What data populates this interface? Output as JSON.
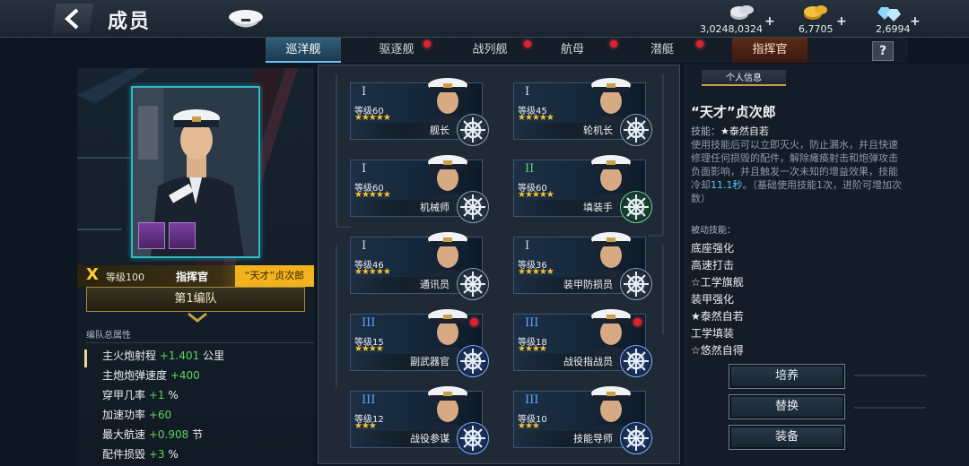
{
  "header": {
    "title": "成员",
    "currencies": [
      {
        "icon": "silver-coins-icon",
        "amount": "3,0248,0324"
      },
      {
        "icon": "gold-coins-icon",
        "amount": "6,7705"
      },
      {
        "icon": "diamond-icon",
        "amount": "2,6994"
      }
    ],
    "plus": "+"
  },
  "tabs": [
    {
      "label": "巡洋舰",
      "active": true,
      "alert": false
    },
    {
      "label": "驱逐舰",
      "active": false,
      "alert": true
    },
    {
      "label": "战列舰",
      "active": false,
      "alert": true
    },
    {
      "label": "航母",
      "active": false,
      "alert": true
    },
    {
      "label": "潜艇",
      "active": false,
      "alert": true
    },
    {
      "label": "指挥官",
      "active": false,
      "alert": false
    }
  ],
  "help_label": "?",
  "commander": {
    "rank": "X",
    "level": "等级100",
    "role": "指挥官",
    "name": "“天才”贞次郎",
    "fleet": "第1编队"
  },
  "fleet_stats": {
    "heading": "编队总属性",
    "rows": [
      {
        "label": "主火炮射程",
        "value": "+1.401",
        "unit": "公里"
      },
      {
        "label": "主炮炮弹速度",
        "value": "+400",
        "unit": ""
      },
      {
        "label": "穿甲几率",
        "value": "+1",
        "unit": "%"
      },
      {
        "label": "加速功率",
        "value": "+60",
        "unit": ""
      },
      {
        "label": "最大航速",
        "value": "+0.908",
        "unit": "节"
      },
      {
        "label": "配件损毁",
        "value": "+3",
        "unit": "%"
      }
    ]
  },
  "crew": [
    {
      "roman": "I",
      "grade": "white",
      "level": "等级60",
      "stars": "★★★★★",
      "role": "舰长",
      "icon": "helm-wheel-icon",
      "alert": false
    },
    {
      "roman": "I",
      "grade": "white",
      "level": "等级45",
      "stars": "★★★★★",
      "role": "轮机长",
      "icon": "gear-icon",
      "alert": false
    },
    {
      "roman": "I",
      "grade": "white",
      "level": "等级60",
      "stars": "★★★★★",
      "role": "机械师",
      "icon": "helm-wheel-icon",
      "alert": false
    },
    {
      "roman": "II",
      "grade": "green",
      "level": "等级60",
      "stars": "★★★★★",
      "role": "填装手",
      "icon": "shell-loader-icon",
      "alert": false
    },
    {
      "roman": "I",
      "grade": "white",
      "level": "等级46",
      "stars": "★★★★★",
      "role": "通讯员",
      "icon": "radio-tower-icon",
      "alert": false
    },
    {
      "roman": "I",
      "grade": "white",
      "level": "等级36",
      "stars": "★★★★★",
      "role": "装甲防损员",
      "icon": "wrench-icon",
      "alert": false
    },
    {
      "roman": "III",
      "grade": "blue",
      "level": "等级15",
      "stars": "★★★★",
      "role": "副武器官",
      "icon": "torpedo-icon",
      "alert": true
    },
    {
      "roman": "III",
      "grade": "blue",
      "level": "等级18",
      "stars": "★★★★",
      "role": "战役指战员",
      "icon": "flag-icon",
      "alert": true
    },
    {
      "roman": "III",
      "grade": "blue",
      "level": "等级12",
      "stars": "★★★",
      "role": "战役参谋",
      "icon": "binoculars-icon",
      "alert": false
    },
    {
      "roman": "III",
      "grade": "blue",
      "level": "等级10",
      "stars": "★★★",
      "role": "技能导师",
      "icon": "gear-icon",
      "alert": false
    }
  ],
  "info_panel": {
    "tab": "个人信息",
    "name": "“天才”贞次郎",
    "skill_label": "技能：",
    "skill_name": "★泰然自若",
    "skill_desc_1": "使用技能后可以立即灭火，防止漏水，并且快速修理任何损毁的配件，解除瘫痪射击和炮弹攻击负面影响，并且触发一次未知的增益效果，技能冷却",
    "skill_desc_hl": "11.1秒",
    "skill_desc_2": "。（基础使用技能1次，进阶可增加次数）",
    "passive_label": "被动技能：",
    "passives": [
      "底座强化",
      "高速打击",
      "☆工学旗舰",
      "装甲强化",
      "★泰然自若",
      "工学填装",
      "☆悠然自得"
    ]
  },
  "actions": [
    "培养",
    "替换",
    "装备"
  ],
  "colors": {
    "accent": "#2fb8c8",
    "gold": "#f2b21e",
    "stat_green": "#5fd35a",
    "alert": "#e0202c"
  }
}
